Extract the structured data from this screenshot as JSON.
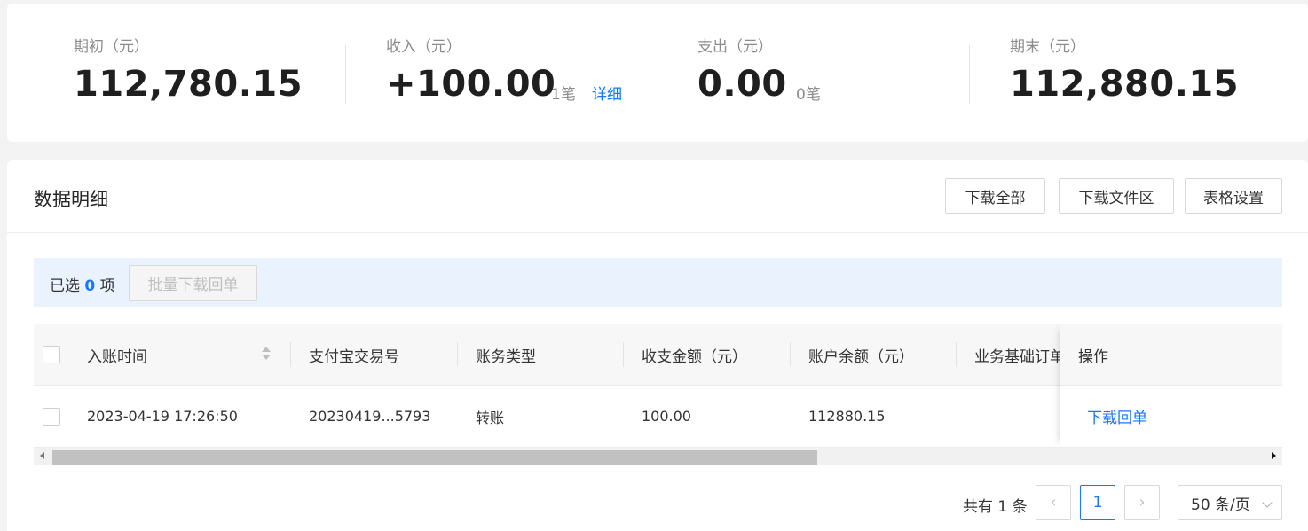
{
  "summary": {
    "opening": {
      "label": "期初（元）",
      "value": "112,780.15"
    },
    "income": {
      "label": "收入（元）",
      "value": "+100.00",
      "count": "1笔",
      "link": "详细"
    },
    "expense": {
      "label": "支出（元）",
      "value": "0.00",
      "count": "0笔"
    },
    "closing": {
      "label": "期末（元）",
      "value": "112,880.15"
    }
  },
  "detail": {
    "title": "数据明细",
    "buttons": {
      "download_all": "下载全部",
      "download_files": "下载文件区",
      "table_settings": "表格设置"
    },
    "selection": {
      "prefix": "已选",
      "count": "0",
      "suffix": "项",
      "batch_button": "批量下载回单"
    },
    "table": {
      "columns": [
        "入账时间",
        "支付宝交易号",
        "账务类型",
        "收支金额（元）",
        "账户余额（元）",
        "业务基础订单号",
        "操作"
      ],
      "rows": [
        {
          "time": "2023-04-19 17:26:50",
          "trade_no": "20230419...5793",
          "type": "转账",
          "amount": "100.00",
          "balance": "112880.15",
          "order_no": "",
          "action": "下载回单"
        }
      ]
    },
    "pagination": {
      "total": "共有 1 条",
      "current": "1",
      "page_size": "50 条/页"
    }
  }
}
